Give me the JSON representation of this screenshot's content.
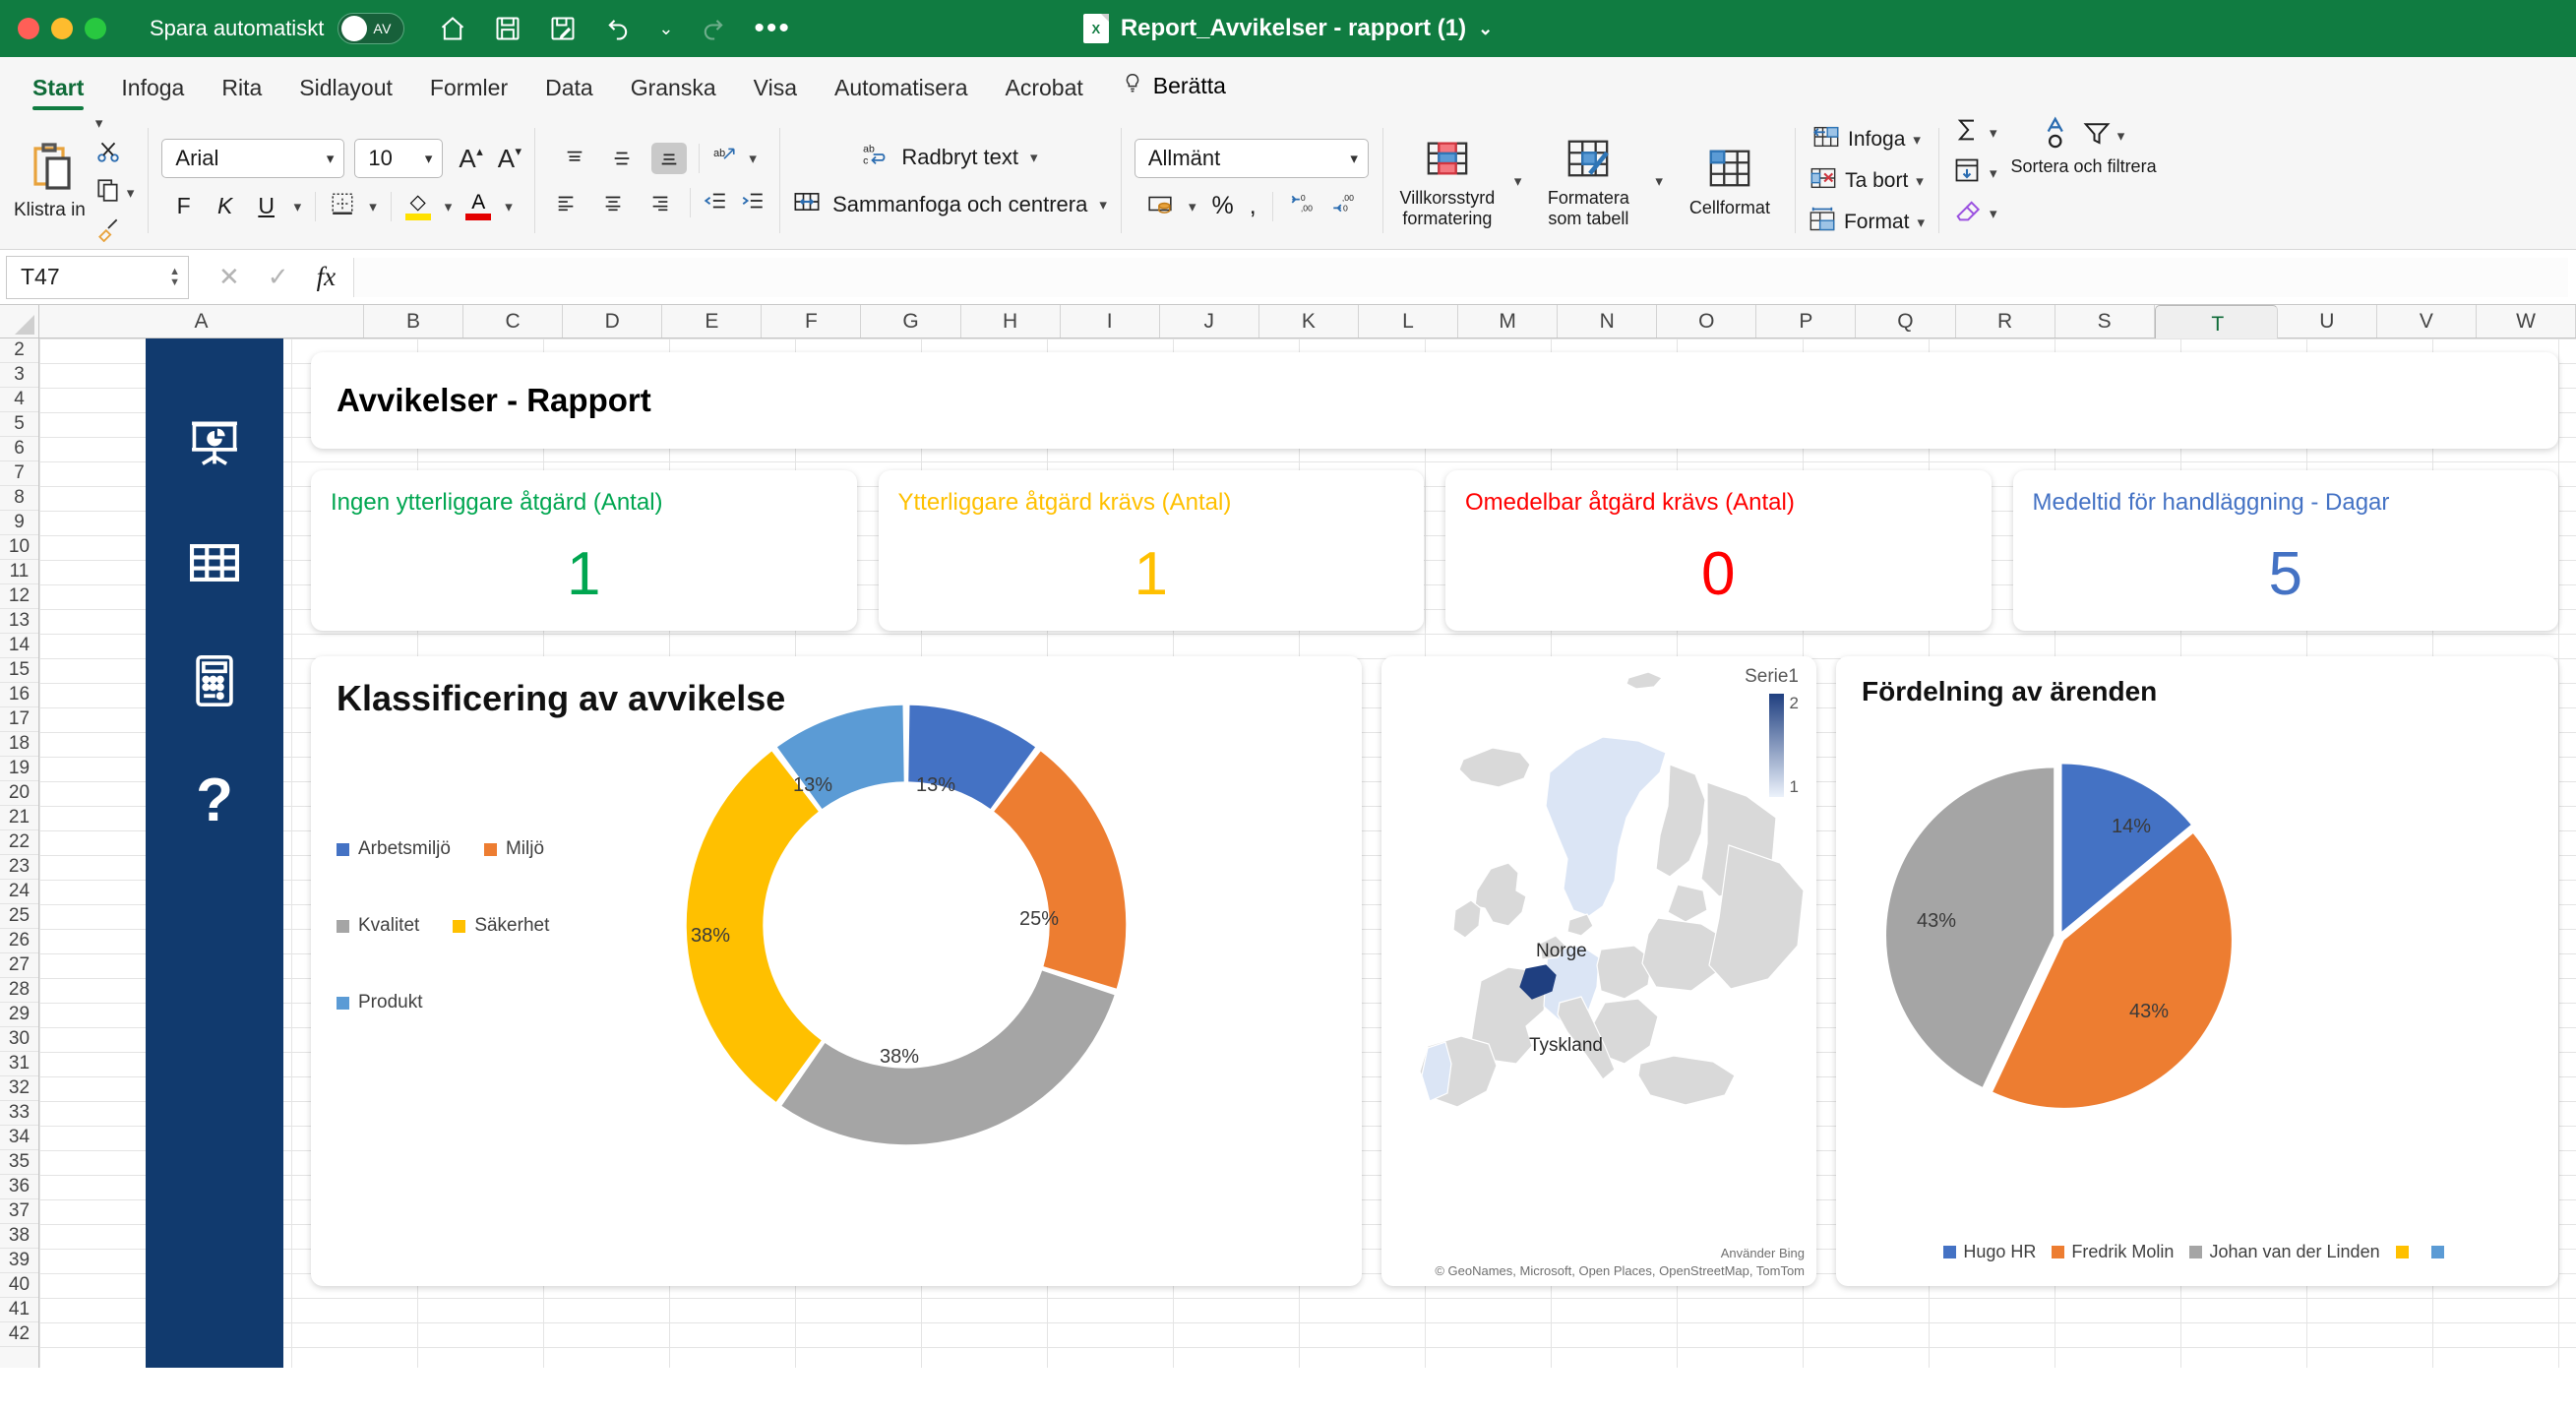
{
  "titlebar": {
    "autosave_label": "Spara automatiskt",
    "autosave_state": "AV",
    "document_title": "Report_Avvikelser - rapport (1)",
    "xl_badge": "X",
    "qat": [
      "home-icon",
      "save-icon",
      "save-as-icon",
      "undo-icon",
      "redo-icon",
      "more-icon"
    ],
    "more_glyph": "•••",
    "chevron": "⌄"
  },
  "ribbon": {
    "tabs": [
      {
        "label": "Start",
        "active": true
      },
      {
        "label": "Infoga",
        "active": false
      },
      {
        "label": "Rita",
        "active": false
      },
      {
        "label": "Sidlayout",
        "active": false
      },
      {
        "label": "Formler",
        "active": false
      },
      {
        "label": "Data",
        "active": false
      },
      {
        "label": "Granska",
        "active": false
      },
      {
        "label": "Visa",
        "active": false
      },
      {
        "label": "Automatisera",
        "active": false
      },
      {
        "label": "Acrobat",
        "active": false
      }
    ],
    "tell_me": "Berätta",
    "clipboard": {
      "paste_label": "Klistra in"
    },
    "font": {
      "family_value": "Arial",
      "size_value": "10",
      "bold": "F",
      "italic": "K",
      "underline": "U"
    },
    "alignment": {
      "wrap_text": "Radbryt text",
      "merge_center": "Sammanfoga och centrera"
    },
    "number": {
      "format_value": "Allmänt",
      "percent": "%",
      "comma": ","
    },
    "styles": [
      {
        "label": "Villkorsstyrd formatering"
      },
      {
        "label": "Formatera som tabell"
      },
      {
        "label": "Cellformat"
      }
    ],
    "cells": [
      {
        "label": "Infoga"
      },
      {
        "label": "Ta bort"
      },
      {
        "label": "Format"
      }
    ],
    "editing": {
      "sort_filter": "Sortera och filtrera"
    }
  },
  "formula_bar": {
    "name_box": "T47",
    "cancel": "✕",
    "confirm": "✓",
    "fx": "fx",
    "formula_value": ""
  },
  "grid": {
    "columns": [
      "A",
      "B",
      "C",
      "D",
      "E",
      "F",
      "G",
      "H",
      "I",
      "J",
      "K",
      "L",
      "M",
      "N",
      "O",
      "P",
      "Q",
      "R",
      "S",
      "T",
      "U",
      "V",
      "W"
    ],
    "selected_column": "T",
    "rows": [
      2,
      3,
      4,
      5,
      6,
      7,
      8,
      9,
      10,
      11,
      12,
      13,
      14,
      15,
      16,
      17,
      18,
      19,
      20,
      21,
      22,
      23,
      24,
      25,
      26,
      27,
      28,
      29,
      30,
      31,
      32,
      33,
      34,
      35,
      36,
      37,
      38,
      39,
      40,
      41,
      42
    ]
  },
  "sidebar": {
    "items": [
      {
        "icon": "presentation-chart-icon"
      },
      {
        "icon": "table-grid-icon"
      },
      {
        "icon": "calculator-icon"
      },
      {
        "icon": "question-mark-icon"
      }
    ]
  },
  "dashboard": {
    "header_title": "Avvikelser - Rapport",
    "kpis": [
      {
        "title": "Ingen ytterliggare åtgärd (Antal)",
        "value": "1",
        "color": "#00a650"
      },
      {
        "title": "Ytterliggare åtgärd krävs (Antal)",
        "value": "1",
        "color": "#ffc000"
      },
      {
        "title": "Omedelbar åtgärd krävs (Antal)",
        "value": "0",
        "color": "#ff0000"
      },
      {
        "title": "Medeltid för handläggning - Dagar",
        "value": "5",
        "color": "#4472c4"
      }
    ]
  },
  "chart_data": [
    {
      "type": "pie",
      "variant": "donut",
      "title": "Klassificering av avvikelse",
      "categories": [
        "Arbetsmiljö",
        "Miljö",
        "Kvalitet",
        "Säkerhet",
        "Produkt"
      ],
      "values": [
        13,
        25,
        38,
        38,
        13
      ],
      "labels": [
        "13%",
        "25%",
        "38%",
        "38%",
        "13%"
      ],
      "colors": [
        "#4472c4",
        "#ed7d31",
        "#a5a5a5",
        "#ffc000",
        "#5b9bd5"
      ],
      "legend_position": "left"
    },
    {
      "type": "map",
      "title": "",
      "series_name": "Serie1",
      "regions": [
        {
          "name": "Norge",
          "value": 1,
          "color": "#dbe5f5"
        },
        {
          "name": "Tyskland",
          "value": 1,
          "color": "#dbe5f5"
        },
        {
          "name": "Belgien",
          "value": 2,
          "color": "#1f3f80"
        },
        {
          "name": "Portugal",
          "value": 1,
          "color": "#dbe5f5"
        }
      ],
      "scale_min": "1",
      "scale_max": "2",
      "attribution_line1": "Använder Bing",
      "attribution_line2": "© GeoNames, Microsoft, Open Places, OpenStreetMap, TomTom"
    },
    {
      "type": "pie",
      "title": "Fördelning av ärenden",
      "categories": [
        "Hugo HR",
        "Fredrik Molin",
        "Johan van der Linden",
        "",
        ""
      ],
      "values": [
        14,
        43,
        43,
        0,
        0
      ],
      "labels": [
        "14%",
        "43%",
        "43%"
      ],
      "colors": [
        "#4472c4",
        "#ed7d31",
        "#a5a5a5",
        "#ffc000",
        "#5b9bd5"
      ],
      "legend_position": "bottom"
    }
  ]
}
